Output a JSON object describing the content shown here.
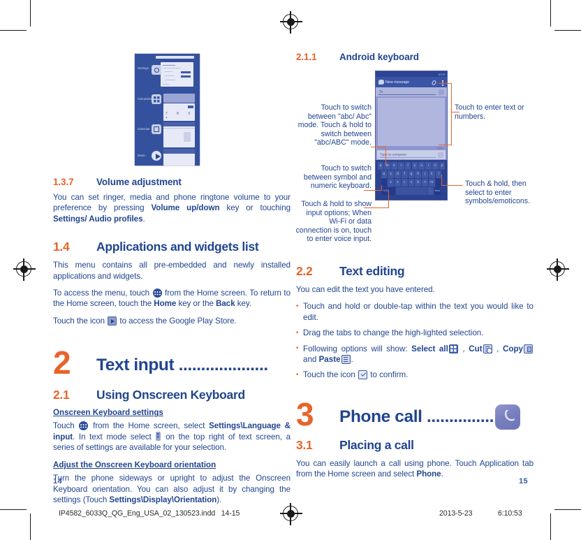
{
  "document": {
    "left_page_number": "14",
    "right_page_number": "15",
    "footer_file": "IP4582_6033Q_QG_Eng_USA_02_130523.indd",
    "footer_pages": "14-15",
    "footer_date": "2013-5-23",
    "footer_time": "6:10:53",
    "accent_orange": "#e8642a",
    "accent_blue": "#21458f"
  },
  "left": {
    "sec137": {
      "num": "1.3.7",
      "title": "Volume adjustment",
      "p1_a": "You can set ringer, media and phone ringtone volume to your preference by pressing ",
      "p1_b": "Volume up/down",
      "p1_c": " key or touching ",
      "p1_d": "Settings/ Audio profiles",
      "p1_e": "."
    },
    "sec14": {
      "num": "1.4",
      "title": "Applications and widgets list",
      "p1": "This menu contains all pre-embedded and newly installed applications and widgets.",
      "p2_a": "To access the menu, touch ",
      "p2_b": " from the Home screen. To return to the Home screen, touch the ",
      "p2_c": "Home",
      "p2_d": " key or the ",
      "p2_e": "Back",
      "p2_f": " key.",
      "p3_a": "Touch the icon ",
      "p3_b": " to access the Google Play Store."
    },
    "chapter2": {
      "number": "2",
      "title": "Text input ...................."
    },
    "sec21": {
      "num": "2.1",
      "title": "Using Onscreen Keyboard",
      "sub1": "Onscreen Keyboard settings",
      "p1_a": "Touch ",
      "p1_b": " from the Home screen, select ",
      "p1_c": "Settings\\Language & input",
      "p1_d": ". In text mode select ",
      "p1_e": " on the top right of text screen, a series of settings are available for your selection.",
      "sub2": "Adjust the Onscreen Keyboard orientation",
      "p2_a": "Turn the phone sideways or upright to adjust the Onscreen Keyboard orientation. You can also adjust it by changing the settings (Touch ",
      "p2_b": "Settings\\Display\\Orientation",
      "p2_c": ")."
    },
    "widget_shot": {
      "rows": [
        {
          "label": "Settings",
          "items": [
            "Wi-Fi",
            "Bluetooth",
            "Data usage",
            "More..."
          ]
        },
        {
          "label": "Calculation",
          "keys": [
            "7",
            "8",
            "9",
            "+"
          ]
        },
        {
          "label": "Calendar",
          "keys": []
        },
        {
          "label": "Music",
          "keys": []
        }
      ]
    }
  },
  "right": {
    "sec211": {
      "num": "2.1.1",
      "title": "Android keyboard"
    },
    "callouts": {
      "abc_mode": "Touch to switch between \"abc/ Abc\" mode. Touch & hold to switch between \"abc/ABC\" mode.",
      "symbol_numeric": "Touch to switch between symbol and numeric keyboard.",
      "input_options": "Touch & hold to show input options; When Wi-Fi or data connection is on, touch to enter voice input.",
      "enter_text": "Touch to enter text or numbers.",
      "symbols_emoticons": "Touch & hold, then select to enter symbols/emoticons."
    },
    "phone": {
      "status_time": "07:27",
      "action_title": "New message",
      "to_label": "To",
      "char_count": "160/1",
      "compose_placeholder": "Type to compose",
      "keys_row1": [
        "q",
        "w",
        "e",
        "r",
        "t",
        "y",
        "u",
        "i",
        "o",
        "p"
      ],
      "keys_row2": [
        "a",
        "s",
        "d",
        "f",
        "g",
        "h",
        "j",
        "k",
        "l"
      ],
      "keys_row3": [
        "z",
        "x",
        "c",
        "v",
        "b",
        "n",
        "m"
      ],
      "key_symbols": "?123",
      "key_period": ".",
      "key_next": "Next"
    },
    "sec22": {
      "num": "2.2",
      "title": "Text editing",
      "p1": "You can edit the text you have entered.",
      "b1": "Touch and hold or double-tap within the text you would like to edit.",
      "b2": "Drag the tabs to change the high-lighted selection.",
      "b3_a": "Following options will show: ",
      "b3_b": "Select all",
      "b3_c": " , ",
      "b3_d": "Cut",
      "b3_e": " , ",
      "b3_f": "Copy",
      "b3_g": " and ",
      "b3_h": "Paste",
      "b3_i": ".",
      "b4_a": "Touch the icon ",
      "b4_b": " to confirm."
    },
    "chapter3": {
      "number": "3",
      "title": "Phone call ..............."
    },
    "sec31": {
      "num": "3.1",
      "title": "Placing a call",
      "p1_a": "You can easily launch a call using phone. Touch Application tab from the Home screen and select ",
      "p1_b": "Phone",
      "p1_c": "."
    }
  }
}
